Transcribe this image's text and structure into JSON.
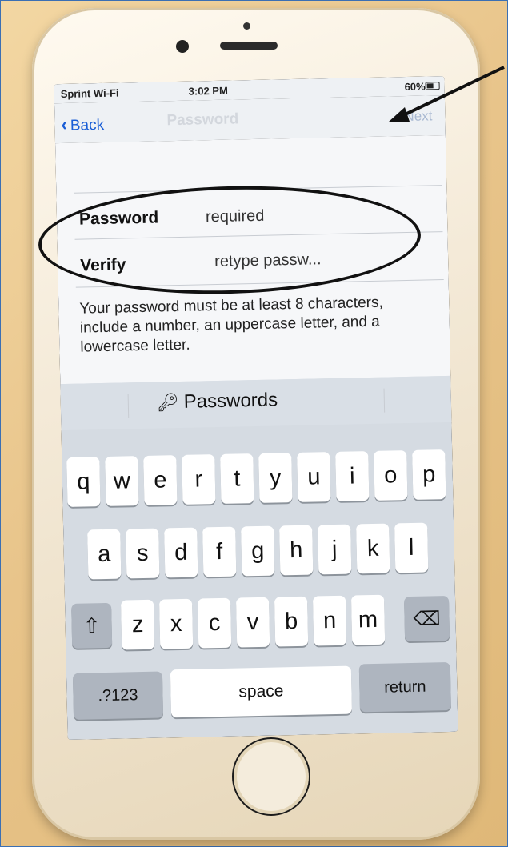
{
  "status": {
    "carrier": "Sprint Wi-Fi",
    "time": "3:02 PM",
    "battery": "60%"
  },
  "nav": {
    "back_label": "Back",
    "title": "Password",
    "next_label": "Next"
  },
  "form": {
    "password_label": "Password",
    "password_placeholder": "required",
    "verify_label": "Verify",
    "verify_placeholder": "retype passw...",
    "hint": "Your password must be at least 8 characters, include a number, an uppercase letter, and a lowercase letter."
  },
  "keyboard": {
    "suggestion": "Passwords",
    "row1": [
      "q",
      "w",
      "e",
      "r",
      "t",
      "y",
      "u",
      "i",
      "o",
      "p"
    ],
    "row2": [
      "a",
      "s",
      "d",
      "f",
      "g",
      "h",
      "j",
      "k",
      "l"
    ],
    "row3": [
      "z",
      "x",
      "c",
      "v",
      "b",
      "n",
      "m"
    ],
    "numbers_label": ".?123",
    "space_label": "space",
    "return_label": "return"
  }
}
